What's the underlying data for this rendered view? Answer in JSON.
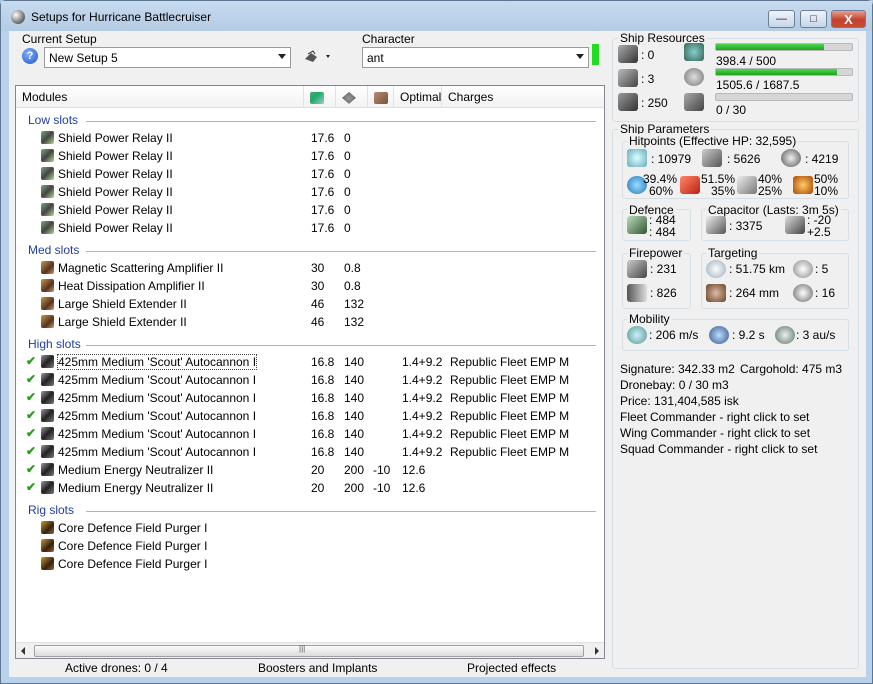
{
  "window": {
    "title": "Setups for Hurricane Battlecruiser",
    "min_glyph": "—",
    "max_glyph": "□",
    "close_glyph": "X"
  },
  "setup": {
    "label": "Current Setup",
    "value": "New Setup 5",
    "help_glyph": "?"
  },
  "character": {
    "label": "Character",
    "value": "ant"
  },
  "modules": {
    "headers": [
      "Modules",
      "",
      "",
      "",
      "Optimal",
      "Charges"
    ],
    "sections": [
      {
        "title": "Low slots",
        "items": [
          {
            "name": "Shield Power Relay II",
            "c1": "17.6",
            "c2": "0",
            "c3": "",
            "c4": "",
            "c5": "",
            "active": false
          },
          {
            "name": "Shield Power Relay II",
            "c1": "17.6",
            "c2": "0",
            "c3": "",
            "c4": "",
            "c5": "",
            "active": false
          },
          {
            "name": "Shield Power Relay II",
            "c1": "17.6",
            "c2": "0",
            "c3": "",
            "c4": "",
            "c5": "",
            "active": false
          },
          {
            "name": "Shield Power Relay II",
            "c1": "17.6",
            "c2": "0",
            "c3": "",
            "c4": "",
            "c5": "",
            "active": false
          },
          {
            "name": "Shield Power Relay II",
            "c1": "17.6",
            "c2": "0",
            "c3": "",
            "c4": "",
            "c5": "",
            "active": false
          },
          {
            "name": "Shield Power Relay II",
            "c1": "17.6",
            "c2": "0",
            "c3": "",
            "c4": "",
            "c5": "",
            "active": false
          }
        ]
      },
      {
        "title": "Med slots",
        "items": [
          {
            "name": "Magnetic Scattering Amplifier II",
            "c1": "30",
            "c2": "0.8",
            "c3": "",
            "c4": "",
            "c5": "",
            "active": false
          },
          {
            "name": "Heat Dissipation Amplifier II",
            "c1": "30",
            "c2": "0.8",
            "c3": "",
            "c4": "",
            "c5": "",
            "active": false
          },
          {
            "name": "Large Shield Extender II",
            "c1": "46",
            "c2": "132",
            "c3": "",
            "c4": "",
            "c5": "",
            "active": false
          },
          {
            "name": "Large Shield Extender II",
            "c1": "46",
            "c2": "132",
            "c3": "",
            "c4": "",
            "c5": "",
            "active": false
          }
        ]
      },
      {
        "title": "High slots",
        "items": [
          {
            "name": "425mm Medium 'Scout' Autocannon I",
            "c1": "16.8",
            "c2": "140",
            "c3": "",
            "c4": "1.4+9.2",
            "c5": "Republic Fleet EMP M",
            "active": true
          },
          {
            "name": "425mm Medium 'Scout' Autocannon I",
            "c1": "16.8",
            "c2": "140",
            "c3": "",
            "c4": "1.4+9.2",
            "c5": "Republic Fleet EMP M",
            "active": true
          },
          {
            "name": "425mm Medium 'Scout' Autocannon I",
            "c1": "16.8",
            "c2": "140",
            "c3": "",
            "c4": "1.4+9.2",
            "c5": "Republic Fleet EMP M",
            "active": true
          },
          {
            "name": "425mm Medium 'Scout' Autocannon I",
            "c1": "16.8",
            "c2": "140",
            "c3": "",
            "c4": "1.4+9.2",
            "c5": "Republic Fleet EMP M",
            "active": true
          },
          {
            "name": "425mm Medium 'Scout' Autocannon I",
            "c1": "16.8",
            "c2": "140",
            "c3": "",
            "c4": "1.4+9.2",
            "c5": "Republic Fleet EMP M",
            "active": true
          },
          {
            "name": "425mm Medium 'Scout' Autocannon I",
            "c1": "16.8",
            "c2": "140",
            "c3": "",
            "c4": "1.4+9.2",
            "c5": "Republic Fleet EMP M",
            "active": true
          },
          {
            "name": "Medium Energy Neutralizer II",
            "c1": "20",
            "c2": "200",
            "c3": "-10",
            "c4": "12.6",
            "c5": "",
            "active": true
          },
          {
            "name": "Medium Energy Neutralizer II",
            "c1": "20",
            "c2": "200",
            "c3": "-10",
            "c4": "12.6",
            "c5": "",
            "active": true
          }
        ]
      },
      {
        "title": "Rig slots",
        "items": [
          {
            "name": "Core Defence Field Purger I",
            "c1": "",
            "c2": "",
            "c3": "",
            "c4": "",
            "c5": "",
            "active": false
          },
          {
            "name": "Core Defence Field Purger I",
            "c1": "",
            "c2": "",
            "c3": "",
            "c4": "",
            "c5": "",
            "active": false
          },
          {
            "name": "Core Defence Field Purger I",
            "c1": "",
            "c2": "",
            "c3": "",
            "c4": "",
            "c5": "",
            "active": false
          }
        ]
      }
    ],
    "check_glyph": "✔",
    "scroll_grip": "|||"
  },
  "status": {
    "drones": "Active drones: 0 / 4",
    "boosters": "Boosters and Implants",
    "projected": "Projected effects"
  },
  "resources": {
    "title": "Ship Resources",
    "turrets": ": 0",
    "launchers": ": 3",
    "calibration": ": 250",
    "cpu": {
      "text": "398.4 / 500",
      "fill": 0.797
    },
    "power": {
      "text": "1505.6 / 1687.5",
      "fill": 0.892
    },
    "drone_bay": {
      "text": "0 / 30",
      "fill": 0
    }
  },
  "params": {
    "title": "Ship Parameters",
    "hitpoints_title": "Hitpoints (Effective HP: 32,595)",
    "shield_hp": ": 10979",
    "armor_hp": ": 5626",
    "structure_hp": ": 4219",
    "res_em": [
      "39.4%",
      "60%"
    ],
    "res_thermal": [
      "51.5%",
      "35%"
    ],
    "res_kinetic": [
      "40%",
      "25%"
    ],
    "res_explosive": [
      "50%",
      "10%"
    ],
    "defence_title": "Defence",
    "defence_vals": [
      ": 484",
      ": 484"
    ],
    "capacitor_title": "Capacitor (Lasts: 3m 5s)",
    "capacitor_amount": ": 3375",
    "capacitor_rates": [
      ": -20",
      "+2.5"
    ],
    "firepower_title": "Firepower",
    "firepower_vals": [
      ": 231",
      ": 826"
    ],
    "targeting_title": "Targeting",
    "targeting_range": ": 51.75 km",
    "targeting_max": ": 5",
    "scan_res": ": 264 mm",
    "sensor": ": 16",
    "mobility_title": "Mobility",
    "speed": ": 206 m/s",
    "align": ": 9.2 s",
    "warp": ": 3 au/s"
  },
  "info": {
    "signature": "Signature: 342.33 m2",
    "cargohold": "Cargohold: 475 m3",
    "dronebay": "Dronebay: 0 / 30 m3",
    "price": "Price: 131,404,585 isk",
    "fleet": "Fleet Commander - right click to set",
    "wing": "Wing Commander - right click to set",
    "squad": "Squad Commander - right click to set"
  }
}
